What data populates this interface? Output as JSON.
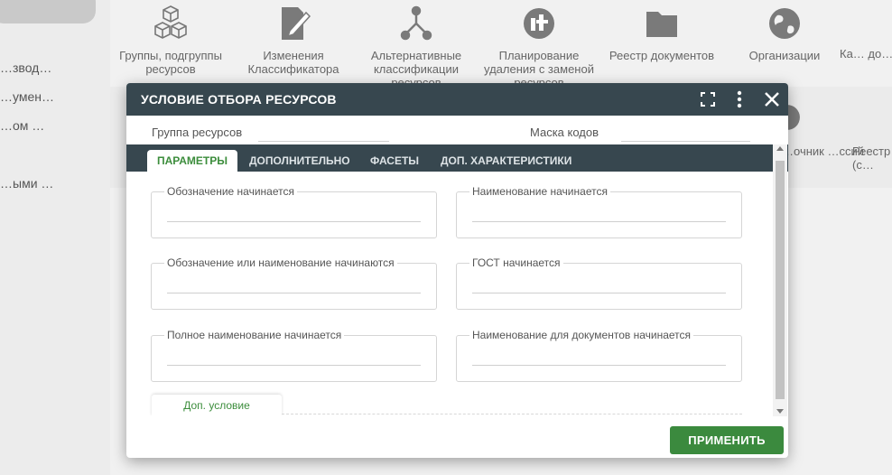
{
  "sidebar": {
    "items": [
      "…звод…",
      "…умен…",
      "…ом …",
      "…ыми …"
    ]
  },
  "tiles": [
    {
      "label": "Группы, подгруппы ресурсов",
      "icon": "cubes-icon"
    },
    {
      "label": "Изменения Классификатора",
      "icon": "edit-document-icon"
    },
    {
      "label": "Альтернативные классификации ресурсов",
      "icon": "branch-icon"
    },
    {
      "label": "Планирование удаления с заменой ресурсов",
      "icon": "planning-icon"
    },
    {
      "label": "Реестр документов",
      "icon": "folder-icon"
    },
    {
      "label": "Организации",
      "icon": "globe-icon"
    },
    {
      "label": "Ка… до…",
      "icon": ""
    },
    {
      "label": "…очник …ссий",
      "icon": "globe-partial-icon"
    },
    {
      "label": "Реестр… (с…",
      "icon": ""
    }
  ],
  "dialog": {
    "title": "УСЛОВИЕ ОТБОРА РЕСУРСОВ",
    "resource_group_label": "Группа ресурсов",
    "code_mask_label": "Маска кодов",
    "tabs": [
      {
        "label": "ПАРАМЕТРЫ",
        "active": true
      },
      {
        "label": "ДОПОЛНИТЕЛЬНО",
        "active": false
      },
      {
        "label": "ФАСЕТЫ",
        "active": false
      },
      {
        "label": "ДОП. ХАРАКТЕРИСТИКИ",
        "active": false
      }
    ],
    "fields": [
      {
        "label": "Обозначение начинается",
        "value": ""
      },
      {
        "label": "Наименование начинается",
        "value": ""
      },
      {
        "label": "Обозначение или наименование начинаются",
        "value": ""
      },
      {
        "label": "ГОСТ начинается",
        "value": ""
      },
      {
        "label": "Полное наименование начинается",
        "value": ""
      },
      {
        "label": "Наименование для документов начинается",
        "value": ""
      }
    ],
    "extra_condition_label": "Доп. условие",
    "apply_label": "ПРИМЕНИТЬ"
  },
  "colors": {
    "header_bg": "#37474f",
    "accent_green": "#3b8a3e",
    "active_tab_text": "#3c8d3c"
  }
}
